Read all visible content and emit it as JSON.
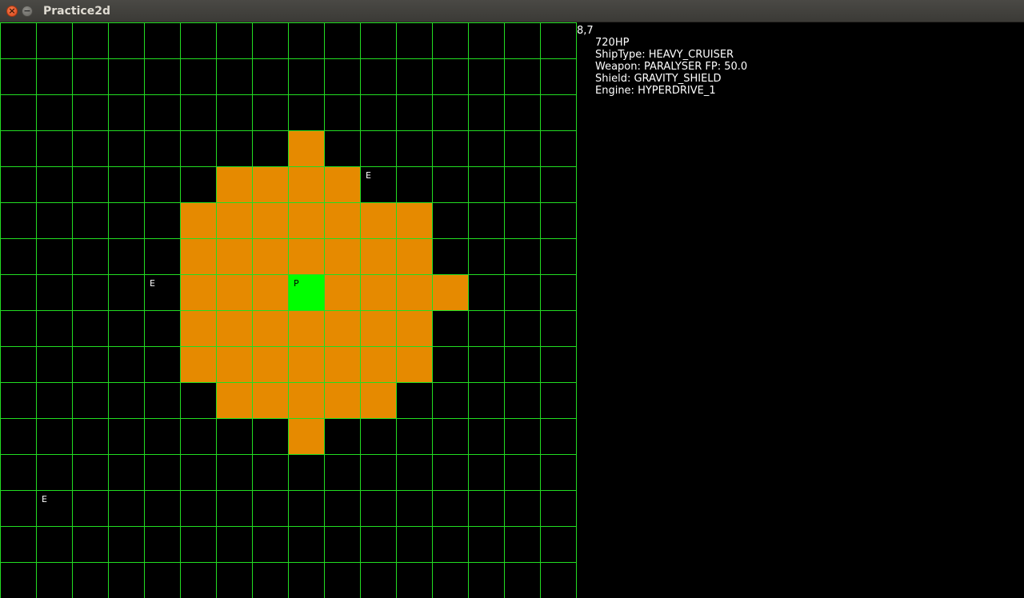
{
  "window": {
    "title": "Practice2d",
    "close_glyph": "×",
    "minimize_glyph": "−"
  },
  "colors": {
    "grid_line": "#22dd22",
    "range_cell": "#e68a00",
    "player_cell": "#00ff00",
    "background": "#000000",
    "text": "#ffffff"
  },
  "grid": {
    "cols": 16,
    "rows": 16,
    "range_cells": [
      [
        8,
        3
      ],
      [
        6,
        4
      ],
      [
        7,
        4
      ],
      [
        8,
        4
      ],
      [
        9,
        4
      ],
      [
        5,
        5
      ],
      [
        6,
        5
      ],
      [
        7,
        5
      ],
      [
        8,
        5
      ],
      [
        9,
        5
      ],
      [
        10,
        5
      ],
      [
        11,
        5
      ],
      [
        5,
        6
      ],
      [
        6,
        6
      ],
      [
        7,
        6
      ],
      [
        8,
        6
      ],
      [
        9,
        6
      ],
      [
        10,
        6
      ],
      [
        11,
        6
      ],
      [
        5,
        7
      ],
      [
        6,
        7
      ],
      [
        7,
        7
      ],
      [
        9,
        7
      ],
      [
        10,
        7
      ],
      [
        11,
        7
      ],
      [
        12,
        7
      ],
      [
        5,
        8
      ],
      [
        6,
        8
      ],
      [
        7,
        8
      ],
      [
        8,
        8
      ],
      [
        9,
        8
      ],
      [
        10,
        8
      ],
      [
        11,
        8
      ],
      [
        5,
        9
      ],
      [
        6,
        9
      ],
      [
        7,
        9
      ],
      [
        8,
        9
      ],
      [
        9,
        9
      ],
      [
        10,
        9
      ],
      [
        11,
        9
      ],
      [
        6,
        10
      ],
      [
        7,
        10
      ],
      [
        8,
        10
      ],
      [
        9,
        10
      ],
      [
        10,
        10
      ],
      [
        8,
        11
      ]
    ],
    "player": {
      "col": 8,
      "row": 7,
      "label": "P"
    },
    "enemies": [
      {
        "col": 10,
        "row": 4,
        "label": "E"
      },
      {
        "col": 4,
        "row": 7,
        "label": "E"
      },
      {
        "col": 1,
        "row": 13,
        "label": "E"
      }
    ]
  },
  "info": {
    "coords": "8,7",
    "hp": "720HP",
    "ship_type": "ShipType: HEAVY_CRUISER",
    "weapon": "Weapon: PARALYSER FP: 50.0",
    "shield": "Shield: GRAVITY_SHIELD",
    "engine": "Engine: HYPERDRIVE_1"
  }
}
